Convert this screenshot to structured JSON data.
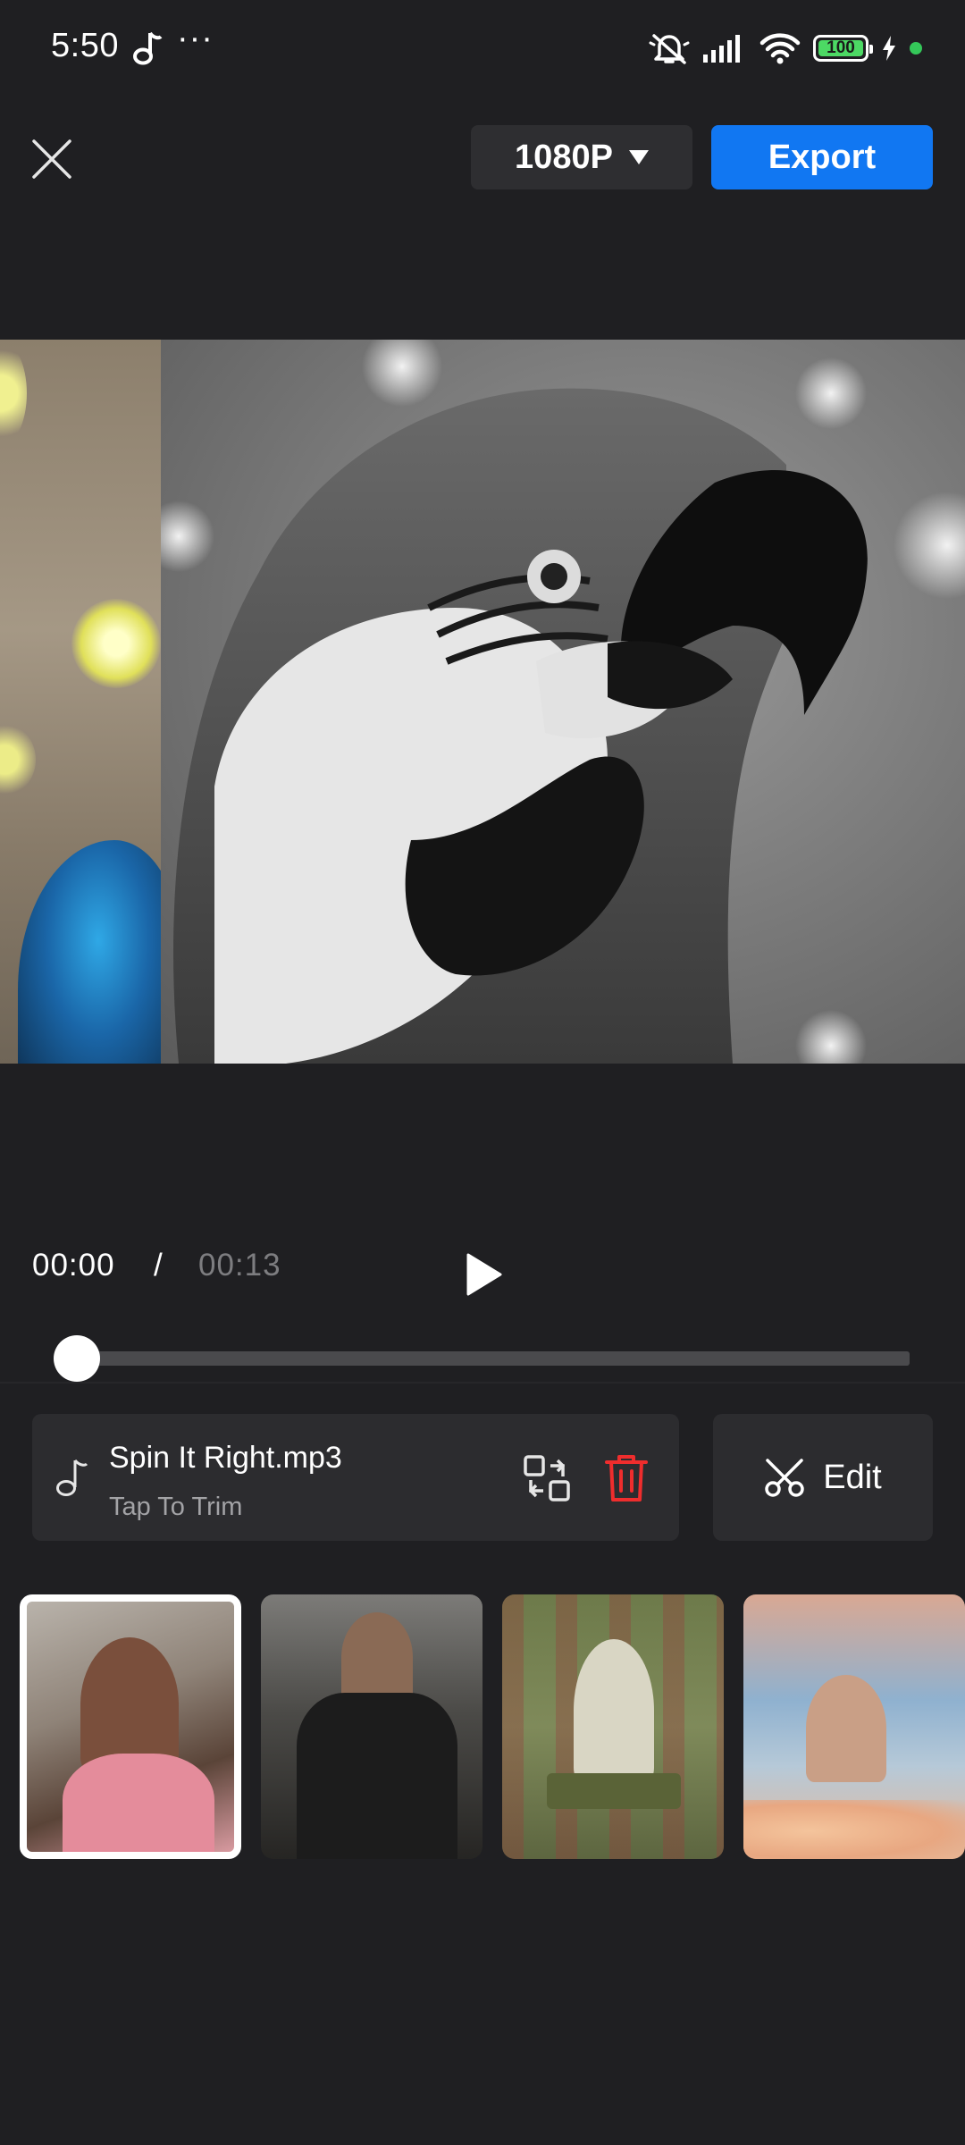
{
  "status_bar": {
    "time": "5:50",
    "more": "···",
    "battery": "100",
    "icons": [
      "music-note-icon",
      "mute-icon",
      "signal-icon",
      "wifi-icon",
      "battery-icon",
      "charging-icon"
    ]
  },
  "top_bar": {
    "resolution": "1080P",
    "export_label": "Export",
    "colors": {
      "export": "#1177f2",
      "background": "#1f1f22"
    }
  },
  "player": {
    "current_time": "00:00",
    "separator": "/",
    "total_time": "00:13",
    "progress": 0.0
  },
  "music": {
    "title": "Spin It Right.mp3",
    "subtitle": "Tap To Trim"
  },
  "edit": {
    "label": "Edit"
  },
  "thumbnails": [
    {
      "selected": true
    },
    {
      "selected": false
    },
    {
      "selected": false
    },
    {
      "selected": false
    }
  ]
}
